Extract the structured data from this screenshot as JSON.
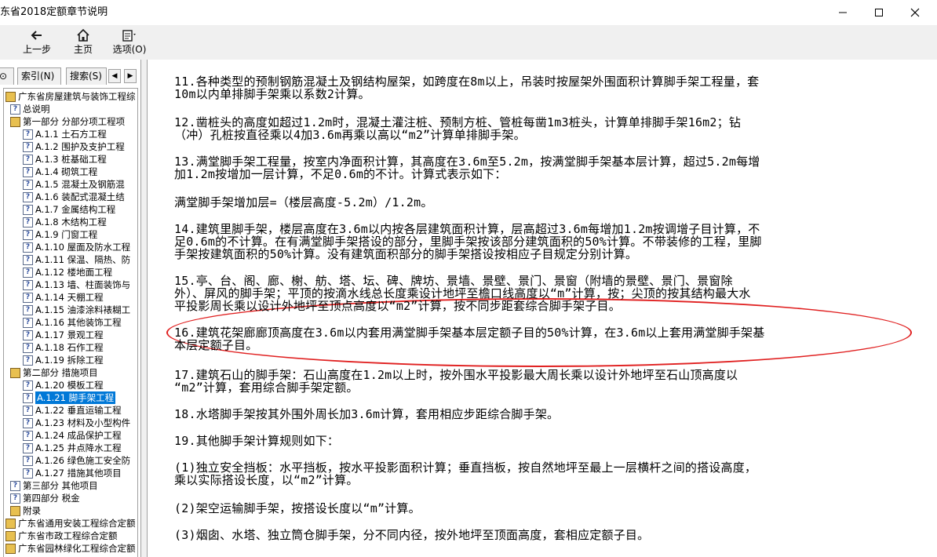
{
  "window": {
    "title": "东省2018定额章节说明",
    "minimize_icon": "minimize-icon",
    "maximize_icon": "maximize-icon",
    "close_icon": "close-icon"
  },
  "toolbar": {
    "back_label": "上一步",
    "home_label": "主页",
    "options_label": "选项(O)"
  },
  "tabs": {
    "contents_label": "⊙",
    "index_label": "索引(N)",
    "search_label": "搜索(S)",
    "prev_arrow": "◀",
    "next_arrow": "▶"
  },
  "tree": [
    {
      "label": "广东省房屋建筑与装饰工程综",
      "icon": "book-icon",
      "indent": 0
    },
    {
      "label": "总说明",
      "icon": "help-doc-icon",
      "indent": 1
    },
    {
      "label": "第一部分 分部分项工程项",
      "icon": "book-icon",
      "indent": 1
    },
    {
      "label": "A.1.1 土石方工程",
      "icon": "help-doc-icon",
      "indent": 2
    },
    {
      "label": "A.1.2 围护及支护工程",
      "icon": "help-doc-icon",
      "indent": 2
    },
    {
      "label": "A.1.3 桩基础工程",
      "icon": "help-doc-icon",
      "indent": 2
    },
    {
      "label": "A.1.4 砌筑工程",
      "icon": "help-doc-icon",
      "indent": 2
    },
    {
      "label": "A.1.5 混凝土及钢筋混",
      "icon": "help-doc-icon",
      "indent": 2
    },
    {
      "label": "A.1.6 装配式混凝土结",
      "icon": "help-doc-icon",
      "indent": 2
    },
    {
      "label": "A.1.7 金属结构工程",
      "icon": "help-doc-icon",
      "indent": 2
    },
    {
      "label": "A.1.8 木结构工程",
      "icon": "help-doc-icon",
      "indent": 2
    },
    {
      "label": "A.1.9 门窗工程",
      "icon": "help-doc-icon",
      "indent": 2
    },
    {
      "label": "A.1.10 屋面及防水工程",
      "icon": "help-doc-icon",
      "indent": 2
    },
    {
      "label": "A.1.11 保温、隔热、防",
      "icon": "help-doc-icon",
      "indent": 2
    },
    {
      "label": "A.1.12 楼地面工程",
      "icon": "help-doc-icon",
      "indent": 2
    },
    {
      "label": "A.1.13 墙、柱面装饰与",
      "icon": "help-doc-icon",
      "indent": 2
    },
    {
      "label": "A.1.14 天棚工程",
      "icon": "help-doc-icon",
      "indent": 2
    },
    {
      "label": "A.1.15 油漆涂料裱糊工",
      "icon": "help-doc-icon",
      "indent": 2
    },
    {
      "label": "A.1.16 其他装饰工程",
      "icon": "help-doc-icon",
      "indent": 2
    },
    {
      "label": "A.1.17 景观工程",
      "icon": "help-doc-icon",
      "indent": 2
    },
    {
      "label": "A.1.18 石作工程",
      "icon": "help-doc-icon",
      "indent": 2
    },
    {
      "label": "A.1.19 拆除工程",
      "icon": "help-doc-icon",
      "indent": 2
    },
    {
      "label": "第二部分 措施项目",
      "icon": "book-icon",
      "indent": 1
    },
    {
      "label": "A.1.20 模板工程",
      "icon": "help-doc-icon",
      "indent": 2
    },
    {
      "label": "A.1.21 脚手架工程",
      "icon": "help-doc-icon",
      "indent": 2,
      "selected": true
    },
    {
      "label": "A.1.22 垂直运输工程",
      "icon": "help-doc-icon",
      "indent": 2
    },
    {
      "label": "A.1.23 材料及小型构件",
      "icon": "help-doc-icon",
      "indent": 2
    },
    {
      "label": "A.1.24 成品保护工程",
      "icon": "help-doc-icon",
      "indent": 2
    },
    {
      "label": "A.1.25 井点降水工程",
      "icon": "help-doc-icon",
      "indent": 2
    },
    {
      "label": "A.1.26 绿色施工安全防",
      "icon": "help-doc-icon",
      "indent": 2
    },
    {
      "label": "A.1.27 措施其他项目",
      "icon": "help-doc-icon",
      "indent": 2
    },
    {
      "label": "第三部分 其他项目",
      "icon": "help-doc-icon",
      "indent": 1
    },
    {
      "label": "第四部分 税金",
      "icon": "help-doc-icon",
      "indent": 1
    },
    {
      "label": "附录",
      "icon": "book-icon",
      "indent": 1
    },
    {
      "label": "广东省通用安装工程综合定额",
      "icon": "book-icon",
      "indent": 0
    },
    {
      "label": "广东省市政工程综合定额",
      "icon": "book-icon",
      "indent": 0
    },
    {
      "label": "广东省园林绿化工程综合定额",
      "icon": "book-icon",
      "indent": 0
    }
  ],
  "content": {
    "paragraphs": [
      [
        "11.各种类型的预制钢筋混凝土及钢结构屋架，如跨度在8m以上，吊装时按屋架外围面积计算脚手架工程量，套",
        "10m以内单排脚手架乘以系数2计算。"
      ],
      [
        "12.凿桩头的高度如超过1.2m时，混凝土灌注桩、预制方桩、管桩每凿1m3桩头，计算单排脚手架16m2；钻",
        "（冲）孔桩按直径乘以4加3.6m再乘以高以“m2”计算单排脚手架。"
      ],
      [
        "13.满堂脚手架工程量，按室内净面积计算，其高度在3.6m至5.2m，按满堂脚手架基本层计算，超过5.2m每增",
        "加1.2m按增加一层计算，不足0.6m的不计。计算式表示如下："
      ],
      [
        "满堂脚手架增加层=（楼层高度-5.2m）/1.2m。"
      ],
      [
        "14.建筑里脚手架，楼层高度在3.6m以内按各层建筑面积计算，层高超过3.6m每增加1.2m按调增子目计算，不",
        "足0.6m的不计算。在有满堂脚手架搭设的部分，里脚手架按该部分建筑面积的50%计算。不带装修的工程，里脚",
        "手架按建筑面积的50%计算。没有建筑面积部分的脚手架搭设按相应子目规定分别计算。"
      ],
      [
        "15.亭、台、阁、廊、榭、舫、塔、坛、碑、牌坊、景墙、景壁、景门、景窗（附墙的景壁、景门、景窗除",
        "外）、屏风的脚手架；平顶的按滴水线总长度乘设计地坪至檐口线高度以“m”计算，按；尖顶的按其结构最大水",
        "平投影周长乘以设计外地坪至顶点高度以“m2”计算，按不同步距套综合脚手架子目。"
      ],
      [
        "16.建筑花架廊廊顶高度在3.6m以内套用满堂脚手架基本层定额子目的50%计算，在3.6m以上套用满堂脚手架基",
        "本层定额子目。"
      ],
      [
        "17.建筑石山的脚手架：石山高度在1.2m以上时，按外围水平投影最大周长乘以设计外地坪至石山顶高度以",
        "“m2”计算，套用综合脚手架定额。"
      ],
      [
        "18.水塔脚手架按其外围外周长加3.6m计算，套用相应步距综合脚手架。"
      ],
      [
        "19.其他脚手架计算规则如下："
      ],
      [
        "(1)独立安全挡板：水平挡板，按水平投影面积计算；垂直挡板，按自然地坪至最上一层横杆之间的搭设高度，",
        "乘以实际搭设长度，以“m2”计算。"
      ],
      [
        "(2)架空运输脚手架，按搭设长度以“m”计算。"
      ],
      [
        "(3)烟囱、水塔、独立筒仓脚手架，分不同内径，按外地坪至顶面高度，套相应定额子目。"
      ]
    ]
  },
  "colors": {
    "selection": "#0078d7",
    "annotation": "#e02020",
    "toolbar_bg": "#f0f0f0"
  }
}
